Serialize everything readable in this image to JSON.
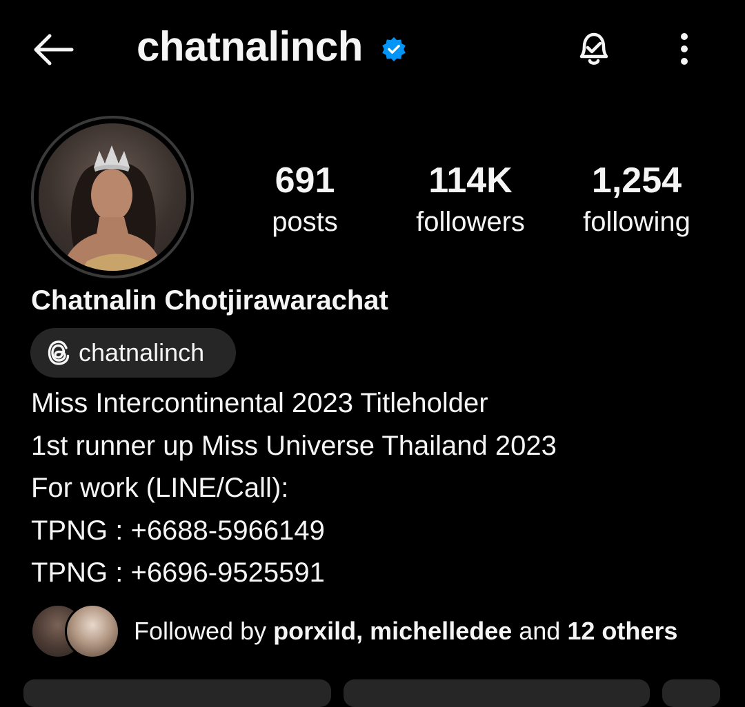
{
  "header": {
    "username": "chatnalinch",
    "verified": true,
    "back_icon": "arrow-left-icon",
    "bell_icon": "bell-check-icon",
    "more_icon": "more-vertical-icon"
  },
  "stats": [
    {
      "number": "691",
      "label": "posts"
    },
    {
      "number": "114K",
      "label": "followers"
    },
    {
      "number": "1,254",
      "label": "following"
    }
  ],
  "profile": {
    "full_name": "Chatnalin Chotjirawarachat",
    "threads_handle": "chatnalinch",
    "bio": [
      "Miss Intercontinental 2023 Titleholder",
      "1st runner up Miss Universe Thailand 2023",
      "For work (LINE/Call):",
      "TPNG : +6688-5966149",
      "TPNG : +6696-9525591"
    ]
  },
  "followed_by": {
    "prefix": "Followed by ",
    "user1": "porxild",
    "separator": ", ",
    "user2": "michelledee",
    "suffix_prefix": " and ",
    "others": "12 others"
  },
  "colors": {
    "background": "#000000",
    "text": "#f5f5f5",
    "pill": "#262626",
    "verified_blue": "#0095f6"
  }
}
